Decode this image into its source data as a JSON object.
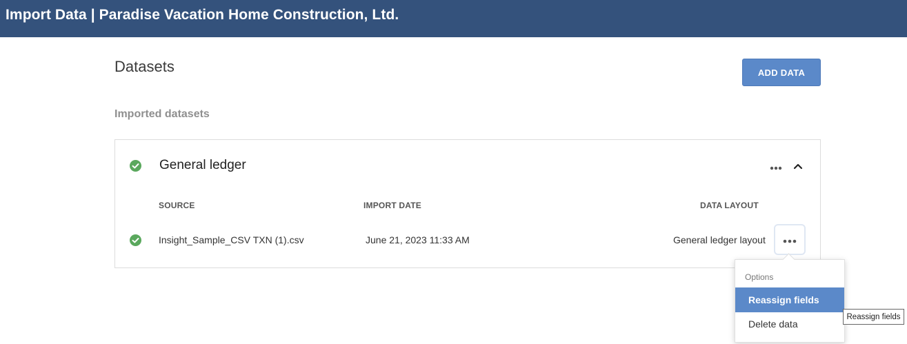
{
  "header": {
    "title": "Import Data | Paradise Vacation Home Construction, Ltd."
  },
  "page": {
    "title": "Datasets",
    "add_button": "ADD DATA",
    "section_title": "Imported datasets"
  },
  "dataset": {
    "name": "General ledger",
    "status_icon": "check-circle-icon",
    "more_icon": "more-horizontal-icon",
    "collapse_icon": "chevron-up-icon",
    "columns": {
      "source": "SOURCE",
      "import_date": "IMPORT DATE",
      "data_layout": "DATA LAYOUT"
    },
    "rows": [
      {
        "source": "Insight_Sample_CSV TXN (1).csv",
        "import_date": "June 21, 2023 11:33 AM",
        "data_layout": "General ledger layout"
      }
    ]
  },
  "menu": {
    "header": "Options",
    "items": [
      {
        "label": "Reassign fields",
        "active": true
      },
      {
        "label": "Delete data",
        "active": false
      }
    ]
  },
  "tooltip": {
    "text": "Reassign fields"
  },
  "colors": {
    "header_bg": "#34527c",
    "accent": "#5b89c9",
    "success": "#5aa85d"
  }
}
